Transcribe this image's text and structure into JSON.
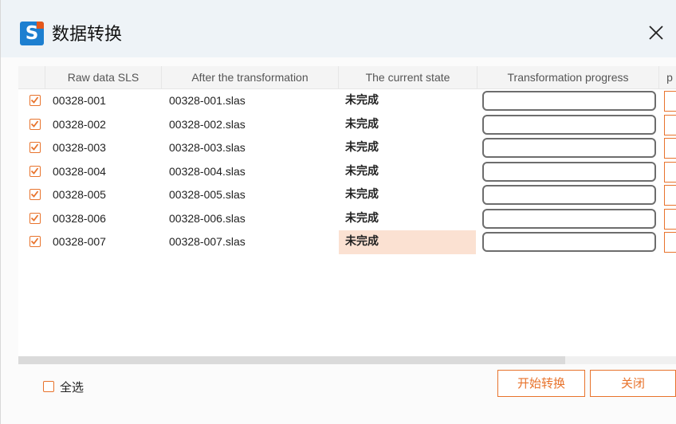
{
  "window": {
    "title": "数据转换",
    "app_icon_letter": "S",
    "close_icon": "close-icon"
  },
  "table": {
    "columns": [
      "",
      "Raw data SLS",
      "After the transformation",
      "The current state",
      "Transformation progress",
      "p"
    ],
    "rows": [
      {
        "checked": true,
        "raw": "00328-001",
        "after": "00328-001.slas",
        "state": "未完成",
        "highlight": false
      },
      {
        "checked": true,
        "raw": "00328-002",
        "after": "00328-002.slas",
        "state": "未完成",
        "highlight": false
      },
      {
        "checked": true,
        "raw": "00328-003",
        "after": "00328-003.slas",
        "state": "未完成",
        "highlight": false
      },
      {
        "checked": true,
        "raw": "00328-004",
        "after": "00328-004.slas",
        "state": "未完成",
        "highlight": false
      },
      {
        "checked": true,
        "raw": "00328-005",
        "after": "00328-005.slas",
        "state": "未完成",
        "highlight": false
      },
      {
        "checked": true,
        "raw": "00328-006",
        "after": "00328-006.slas",
        "state": "未完成",
        "highlight": false
      },
      {
        "checked": true,
        "raw": "00328-007",
        "after": "00328-007.slas",
        "state": "未完成",
        "highlight": true
      }
    ]
  },
  "footer": {
    "select_all_label": "全选",
    "select_all_checked": false,
    "start_button": "开始转换",
    "close_button": "关闭"
  },
  "colors": {
    "accent": "#e8732c",
    "highlight": "#fbe1d2",
    "titlebar": "#eef3f7",
    "icon_blue": "#1d7fd0"
  }
}
